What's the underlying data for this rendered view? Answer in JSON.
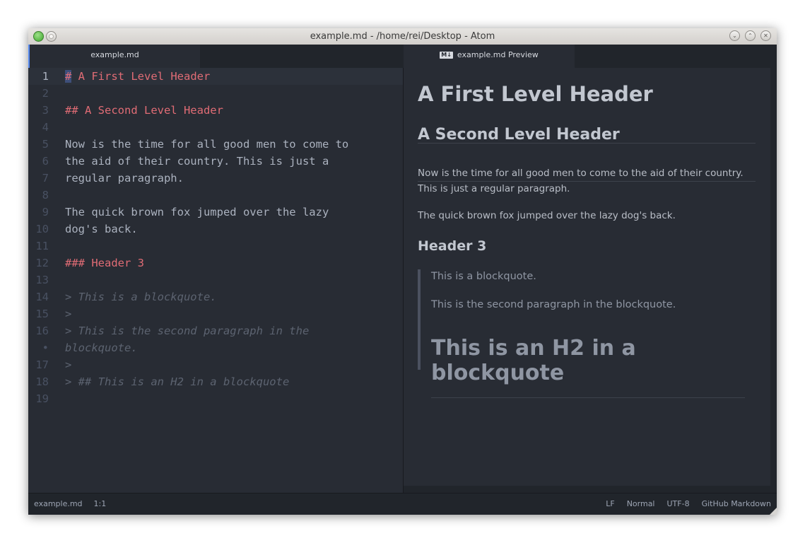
{
  "window": {
    "title": "example.md - /home/rei/Desktop - Atom",
    "buttons": [
      "minimize",
      "maximize",
      "close"
    ]
  },
  "tabs": [
    {
      "label": "example.md"
    },
    {
      "label": "example.md Preview",
      "icon": "markdown-icon",
      "icon_text": "M↓"
    }
  ],
  "editor": {
    "lines": [
      {
        "n": "1",
        "text": "# A First Level Header",
        "kind": "hdr"
      },
      {
        "n": "2",
        "text": "",
        "kind": "para"
      },
      {
        "n": "3",
        "text": "## A Second Level Header",
        "kind": "hdr"
      },
      {
        "n": "4",
        "text": "",
        "kind": "para"
      },
      {
        "n": "5",
        "text": "Now is the time for all good men to come to",
        "kind": "para"
      },
      {
        "n": "6",
        "text": "the aid of their country. This is just a",
        "kind": "para"
      },
      {
        "n": "7",
        "text": "regular paragraph.",
        "kind": "para"
      },
      {
        "n": "8",
        "text": "",
        "kind": "para"
      },
      {
        "n": "9",
        "text": "The quick brown fox jumped over the lazy",
        "kind": "para"
      },
      {
        "n": "10",
        "text": "dog's back.",
        "kind": "para"
      },
      {
        "n": "11",
        "text": "",
        "kind": "para"
      },
      {
        "n": "12",
        "text": "### Header 3",
        "kind": "hdr"
      },
      {
        "n": "13",
        "text": "",
        "kind": "para"
      },
      {
        "n": "14",
        "text": "> This is a blockquote.",
        "kind": "quote"
      },
      {
        "n": "15",
        "text": ">",
        "kind": "quote"
      },
      {
        "n": "16",
        "text": "> This is the second paragraph in the",
        "kind": "quote"
      },
      {
        "n": "•",
        "text": "blockquote.",
        "kind": "quote"
      },
      {
        "n": "17",
        "text": ">",
        "kind": "quote"
      },
      {
        "n": "18",
        "text": "> ## This is an H2 in a blockquote",
        "kind": "quote"
      },
      {
        "n": "19",
        "text": "",
        "kind": "para"
      }
    ]
  },
  "preview": {
    "h1": "A First Level Header",
    "h2": "A Second Level Header",
    "p1": "Now is the time for all good men to come to the aid of their country. This is just a regular paragraph.",
    "p2": "The quick brown fox jumped over the lazy dog's back.",
    "h3": "Header 3",
    "blockquote": {
      "p1": "This is a blockquote.",
      "p2": "This is the second paragraph in the blockquote.",
      "h2": "This is an H2 in a blockquote"
    }
  },
  "status": {
    "file": "example.md",
    "cursor": "1:1",
    "line_ending": "LF",
    "mode": "Normal",
    "encoding": "UTF-8",
    "grammar": "GitHub Markdown"
  },
  "colors": {
    "accent": "#568af2",
    "heading": "#e06c75",
    "text": "#abb2bf",
    "comment": "#5c6370",
    "background": "#282c34"
  }
}
